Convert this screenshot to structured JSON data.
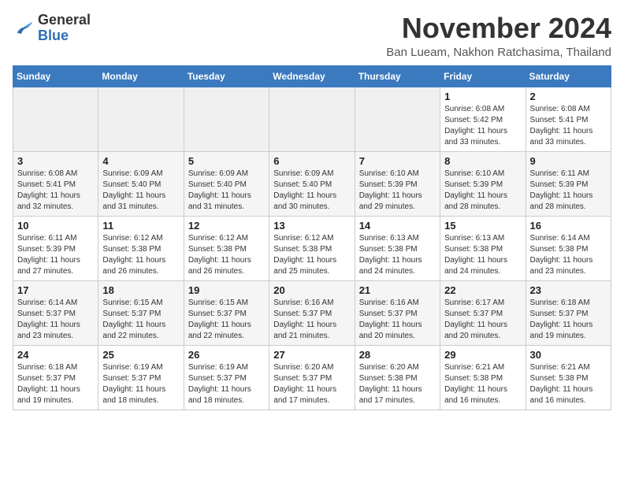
{
  "header": {
    "logo_general": "General",
    "logo_blue": "Blue",
    "month_title": "November 2024",
    "subtitle": "Ban Lueam, Nakhon Ratchasima, Thailand"
  },
  "days_of_week": [
    "Sunday",
    "Monday",
    "Tuesday",
    "Wednesday",
    "Thursday",
    "Friday",
    "Saturday"
  ],
  "weeks": [
    [
      {
        "day": "",
        "empty": true
      },
      {
        "day": "",
        "empty": true
      },
      {
        "day": "",
        "empty": true
      },
      {
        "day": "",
        "empty": true
      },
      {
        "day": "",
        "empty": true
      },
      {
        "day": "1",
        "sunrise": "Sunrise: 6:08 AM",
        "sunset": "Sunset: 5:42 PM",
        "daylight": "Daylight: 11 hours and 33 minutes."
      },
      {
        "day": "2",
        "sunrise": "Sunrise: 6:08 AM",
        "sunset": "Sunset: 5:41 PM",
        "daylight": "Daylight: 11 hours and 33 minutes."
      }
    ],
    [
      {
        "day": "3",
        "sunrise": "Sunrise: 6:08 AM",
        "sunset": "Sunset: 5:41 PM",
        "daylight": "Daylight: 11 hours and 32 minutes."
      },
      {
        "day": "4",
        "sunrise": "Sunrise: 6:09 AM",
        "sunset": "Sunset: 5:40 PM",
        "daylight": "Daylight: 11 hours and 31 minutes."
      },
      {
        "day": "5",
        "sunrise": "Sunrise: 6:09 AM",
        "sunset": "Sunset: 5:40 PM",
        "daylight": "Daylight: 11 hours and 31 minutes."
      },
      {
        "day": "6",
        "sunrise": "Sunrise: 6:09 AM",
        "sunset": "Sunset: 5:40 PM",
        "daylight": "Daylight: 11 hours and 30 minutes."
      },
      {
        "day": "7",
        "sunrise": "Sunrise: 6:10 AM",
        "sunset": "Sunset: 5:39 PM",
        "daylight": "Daylight: 11 hours and 29 minutes."
      },
      {
        "day": "8",
        "sunrise": "Sunrise: 6:10 AM",
        "sunset": "Sunset: 5:39 PM",
        "daylight": "Daylight: 11 hours and 28 minutes."
      },
      {
        "day": "9",
        "sunrise": "Sunrise: 6:11 AM",
        "sunset": "Sunset: 5:39 PM",
        "daylight": "Daylight: 11 hours and 28 minutes."
      }
    ],
    [
      {
        "day": "10",
        "sunrise": "Sunrise: 6:11 AM",
        "sunset": "Sunset: 5:39 PM",
        "daylight": "Daylight: 11 hours and 27 minutes."
      },
      {
        "day": "11",
        "sunrise": "Sunrise: 6:12 AM",
        "sunset": "Sunset: 5:38 PM",
        "daylight": "Daylight: 11 hours and 26 minutes."
      },
      {
        "day": "12",
        "sunrise": "Sunrise: 6:12 AM",
        "sunset": "Sunset: 5:38 PM",
        "daylight": "Daylight: 11 hours and 26 minutes."
      },
      {
        "day": "13",
        "sunrise": "Sunrise: 6:12 AM",
        "sunset": "Sunset: 5:38 PM",
        "daylight": "Daylight: 11 hours and 25 minutes."
      },
      {
        "day": "14",
        "sunrise": "Sunrise: 6:13 AM",
        "sunset": "Sunset: 5:38 PM",
        "daylight": "Daylight: 11 hours and 24 minutes."
      },
      {
        "day": "15",
        "sunrise": "Sunrise: 6:13 AM",
        "sunset": "Sunset: 5:38 PM",
        "daylight": "Daylight: 11 hours and 24 minutes."
      },
      {
        "day": "16",
        "sunrise": "Sunrise: 6:14 AM",
        "sunset": "Sunset: 5:38 PM",
        "daylight": "Daylight: 11 hours and 23 minutes."
      }
    ],
    [
      {
        "day": "17",
        "sunrise": "Sunrise: 6:14 AM",
        "sunset": "Sunset: 5:37 PM",
        "daylight": "Daylight: 11 hours and 23 minutes."
      },
      {
        "day": "18",
        "sunrise": "Sunrise: 6:15 AM",
        "sunset": "Sunset: 5:37 PM",
        "daylight": "Daylight: 11 hours and 22 minutes."
      },
      {
        "day": "19",
        "sunrise": "Sunrise: 6:15 AM",
        "sunset": "Sunset: 5:37 PM",
        "daylight": "Daylight: 11 hours and 22 minutes."
      },
      {
        "day": "20",
        "sunrise": "Sunrise: 6:16 AM",
        "sunset": "Sunset: 5:37 PM",
        "daylight": "Daylight: 11 hours and 21 minutes."
      },
      {
        "day": "21",
        "sunrise": "Sunrise: 6:16 AM",
        "sunset": "Sunset: 5:37 PM",
        "daylight": "Daylight: 11 hours and 20 minutes."
      },
      {
        "day": "22",
        "sunrise": "Sunrise: 6:17 AM",
        "sunset": "Sunset: 5:37 PM",
        "daylight": "Daylight: 11 hours and 20 minutes."
      },
      {
        "day": "23",
        "sunrise": "Sunrise: 6:18 AM",
        "sunset": "Sunset: 5:37 PM",
        "daylight": "Daylight: 11 hours and 19 minutes."
      }
    ],
    [
      {
        "day": "24",
        "sunrise": "Sunrise: 6:18 AM",
        "sunset": "Sunset: 5:37 PM",
        "daylight": "Daylight: 11 hours and 19 minutes."
      },
      {
        "day": "25",
        "sunrise": "Sunrise: 6:19 AM",
        "sunset": "Sunset: 5:37 PM",
        "daylight": "Daylight: 11 hours and 18 minutes."
      },
      {
        "day": "26",
        "sunrise": "Sunrise: 6:19 AM",
        "sunset": "Sunset: 5:37 PM",
        "daylight": "Daylight: 11 hours and 18 minutes."
      },
      {
        "day": "27",
        "sunrise": "Sunrise: 6:20 AM",
        "sunset": "Sunset: 5:37 PM",
        "daylight": "Daylight: 11 hours and 17 minutes."
      },
      {
        "day": "28",
        "sunrise": "Sunrise: 6:20 AM",
        "sunset": "Sunset: 5:38 PM",
        "daylight": "Daylight: 11 hours and 17 minutes."
      },
      {
        "day": "29",
        "sunrise": "Sunrise: 6:21 AM",
        "sunset": "Sunset: 5:38 PM",
        "daylight": "Daylight: 11 hours and 16 minutes."
      },
      {
        "day": "30",
        "sunrise": "Sunrise: 6:21 AM",
        "sunset": "Sunset: 5:38 PM",
        "daylight": "Daylight: 11 hours and 16 minutes."
      }
    ]
  ]
}
